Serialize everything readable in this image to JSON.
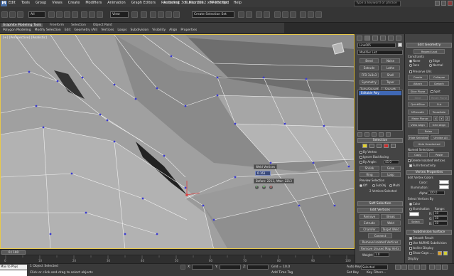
{
  "window": {
    "title": "Autodesk 3ds Max 2012 x64      Untitled",
    "search_placeholder": "Type a keyword or phrase",
    "menus": [
      "Edit",
      "Tools",
      "Group",
      "Views",
      "Create",
      "Modifiers",
      "Animation",
      "Graph Editors",
      "Rendering",
      "Customize",
      "MAXScript",
      "Help"
    ]
  },
  "toolbar": {
    "selection_filter": "All",
    "ref_coord": "View",
    "named_set": "Create Selection Set"
  },
  "ribbon": {
    "tabs": [
      "Graphite Modeling Tools",
      "Freeform",
      "Selection",
      "Object Paint"
    ],
    "items": [
      "Polygon Modeling",
      "Modify Selection",
      "Edit",
      "Geometry (All)",
      "Vertices",
      "Loops",
      "Subdivision",
      "Visibility",
      "Align",
      "Properties"
    ]
  },
  "viewport": {
    "label": "[+] [Perspective] [Realistic]",
    "caddy": {
      "title": "Weld Vertices",
      "threshold": "0.161",
      "before_after": "Before: 2213, After: 2213"
    }
  },
  "command_panel": {
    "object_name": "Line005",
    "modifier_list": "Modifier List",
    "modifier_buttons": [
      [
        "Bend",
        "Noise"
      ],
      [
        "Extrude",
        "Lathe"
      ],
      [
        "FFD 3x3x3",
        "Shell"
      ],
      [
        "Symmetry",
        "Taper"
      ],
      [
        "TurboSmooth",
        "Smooth"
      ]
    ],
    "stack_item": "Editable Poly",
    "selection": {
      "header": "Selection",
      "by_vertex": "By Vertex",
      "ignore_backfacing": "Ignore Backfacing",
      "by_angle": "By Angle:",
      "angle_value": "45.0",
      "shrink": "Shrink",
      "grow": "Grow",
      "ring": "Ring",
      "loop": "Loop",
      "preview": "Preview Selection",
      "off": "Off",
      "subobj": "SubObj",
      "multi": "Multi",
      "status": "2 Vertices Selected"
    },
    "soft_selection": "Soft Selection",
    "edit_vertices": {
      "header": "Edit Vertices",
      "remove": "Remove",
      "break": "Break",
      "extrude": "Extrude",
      "weld": "Weld",
      "chamfer": "Chamfer",
      "target_weld": "Target Weld",
      "connect": "Connect",
      "remove_isolated": "Remove Isolated Vertices",
      "remove_unused": "Remove Unused Map Verts",
      "weight_label": "Weight:",
      "weight_value": "1.0"
    }
  },
  "right_panel": {
    "edit_geometry": "Edit Geometry",
    "repeat_last": "Repeat Last",
    "constraints": "Constraints",
    "none": "None",
    "edge": "Edge",
    "face": "Face",
    "normal": "Normal",
    "preserve_uvs": "Preserve UVs",
    "create": "Create",
    "collapse": "Collapse",
    "attach": "Attach",
    "detach": "Detach",
    "slice_plane": "Slice Plane",
    "split": "Split",
    "slice": "Slice",
    "reset_plane": "Reset Plane",
    "quickslice": "QuickSlice",
    "cut": "Cut",
    "msmooth": "MSmooth",
    "tessellate": "Tessellate",
    "make_planar": "Make Planar",
    "x": "X",
    "y": "Y",
    "z": "Z",
    "view_align": "View Align",
    "grid_align": "Grid Align",
    "relax": "Relax",
    "hide_selected": "Hide Selected",
    "unhide_all": "Unhide All",
    "hide_unselected": "Hide Unselected",
    "named_selections": "Named Selections:",
    "copy": "Copy",
    "paste": "Paste",
    "delete_isolated": "Delete Isolated Vertices",
    "full_interactivity": "Full Interactivity",
    "vertex_properties": "Vertex Properties",
    "edit_vertex_colors": "Edit Vertex Colors",
    "color": "Color:",
    "illumination": "Illumination:",
    "alpha_label": "Alpha:",
    "alpha_value": "100.0",
    "select_vertices_by": "Select Vertices By",
    "sv_color": "Color",
    "sv_illumination": "Illumination",
    "range": "Range:",
    "r": "R:",
    "g": "G:",
    "b": "B:",
    "range_value": "10",
    "select": "Select",
    "subdivision_surface": "Subdivision Surface",
    "smooth_result": "Smooth Result",
    "use_nurms": "Use NURMS Subdivision",
    "isoline_display": "Isoline Display",
    "show_cage": "Show Cage......",
    "display": "Display"
  },
  "timeline": {
    "slider": "0 / 100",
    "ticks": [
      "0",
      "10",
      "20",
      "30",
      "40",
      "50",
      "60",
      "70",
      "80",
      "90",
      "100"
    ]
  },
  "status": {
    "maxscript": "Max to Phys",
    "objects_selected": "1 Object Selected",
    "prompt": "Click or click-and-drag to select objects",
    "x_label": "X:",
    "y_label": "Y:",
    "z_label": "Z:",
    "grid": "Grid = 10.0",
    "auto_key": "Auto Key",
    "selected": "Selected",
    "set_key": "Set Key",
    "key_filters": "Key Filters...",
    "add_time_tag": "Add Time Tag"
  },
  "colors": {
    "viewport_bg": "#7d7d7d",
    "active_border": "#e8c84a",
    "vertex": "#3b3bd0",
    "stack_highlight": "#3f68b5"
  }
}
